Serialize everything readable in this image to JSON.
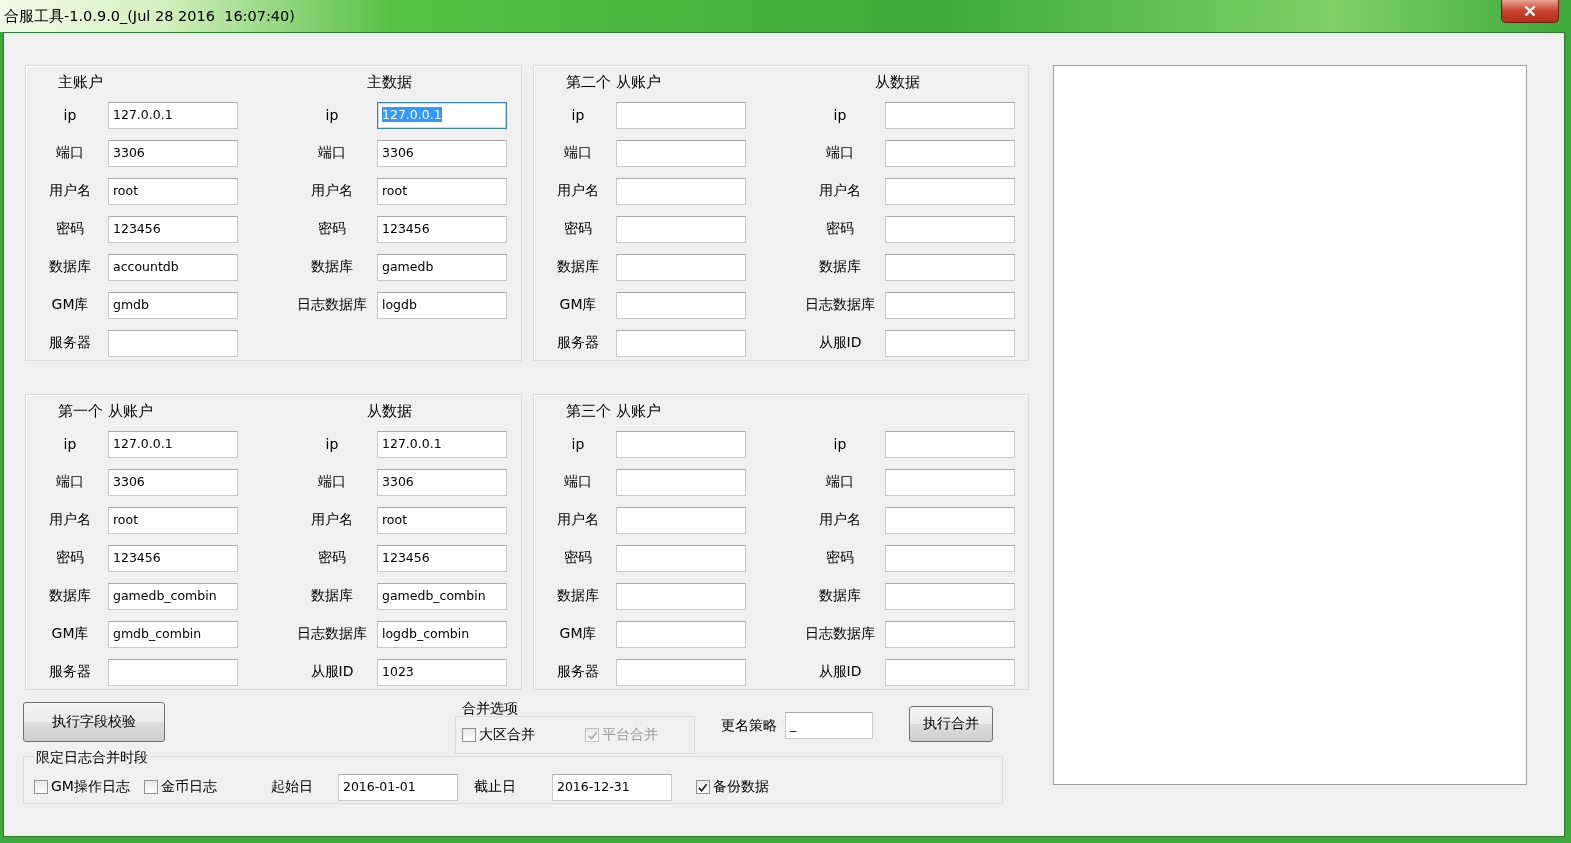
{
  "window": {
    "title": "合服工具-1.0.9.0_(Jul 28 2016  16:07:40)"
  },
  "panels": [
    {
      "columns": [
        {
          "heading": "主账户",
          "fields": [
            {
              "label": "ip",
              "value": "127.0.0.1",
              "highlighted": false
            },
            {
              "label": "端口",
              "value": "3306",
              "highlighted": false
            },
            {
              "label": "用户名",
              "value": "root",
              "highlighted": false
            },
            {
              "label": "密码",
              "value": "123456",
              "highlighted": false
            },
            {
              "label": "数据库",
              "value": "accountdb",
              "highlighted": false
            },
            {
              "label": "GM库",
              "value": "gmdb",
              "highlighted": false
            },
            {
              "label": "服务器",
              "highlighted": false
            }
          ]
        },
        {
          "heading": "主数据",
          "fields": [
            {
              "label": "ip",
              "value": "127.0.0.1",
              "highlighted": true
            },
            {
              "label": "端口",
              "value": "3306",
              "highlighted": false
            },
            {
              "label": "用户名",
              "value": "root",
              "highlighted": false
            },
            {
              "label": "密码",
              "value": "123456",
              "highlighted": false
            },
            {
              "label": "数据库",
              "value": "gamedb",
              "highlighted": false
            },
            {
              "label": "日志数据库",
              "value": "logdb",
              "highlighted": false
            }
          ]
        }
      ]
    },
    {
      "columns": [
        {
          "heading": "第二个 从账户",
          "fields": [
            {
              "label": "ip",
              "highlighted": false
            },
            {
              "label": "端口",
              "highlighted": false
            },
            {
              "label": "用户名",
              "highlighted": false
            },
            {
              "label": "密码",
              "highlighted": false
            },
            {
              "label": "数据库",
              "highlighted": false
            },
            {
              "label": "GM库",
              "highlighted": false
            },
            {
              "label": "服务器",
              "highlighted": false
            }
          ]
        },
        {
          "heading": "从数据",
          "fields": [
            {
              "label": "ip",
              "highlighted": false
            },
            {
              "label": "端口",
              "highlighted": false
            },
            {
              "label": "用户名",
              "highlighted": false
            },
            {
              "label": "密码",
              "highlighted": false
            },
            {
              "label": "数据库",
              "highlighted": false
            },
            {
              "label": "日志数据库",
              "highlighted": false
            },
            {
              "label": "从服ID",
              "highlighted": false
            }
          ]
        }
      ]
    },
    {
      "columns": [
        {
          "heading": "第一个 从账户",
          "fields": [
            {
              "label": "ip",
              "value": "127.0.0.1",
              "highlighted": false
            },
            {
              "label": "端口",
              "value": "3306",
              "highlighted": false
            },
            {
              "label": "用户名",
              "value": "root",
              "highlighted": false
            },
            {
              "label": "密码",
              "value": "123456",
              "highlighted": false
            },
            {
              "label": "数据库",
              "value": "gamedb_combin",
              "highlighted": false
            },
            {
              "label": "GM库",
              "value": "gmdb_combin",
              "highlighted": false
            },
            {
              "label": "服务器",
              "highlighted": false
            }
          ]
        },
        {
          "heading": "从数据",
          "fields": [
            {
              "label": "ip",
              "value": "127.0.0.1",
              "highlighted": false
            },
            {
              "label": "端口",
              "value": "3306",
              "highlighted": false
            },
            {
              "label": "用户名",
              "value": "root",
              "highlighted": false
            },
            {
              "label": "密码",
              "value": "123456",
              "highlighted": false
            },
            {
              "label": "数据库",
              "value": "gamedb_combin",
              "highlighted": false
            },
            {
              "label": "日志数据库",
              "value": "logdb_combin",
              "highlighted": false
            },
            {
              "label": "从服ID",
              "value": "1023",
              "highlighted": false
            }
          ]
        }
      ]
    },
    {
      "columns": [
        {
          "heading": "第三个 从账户",
          "fields": [
            {
              "label": "ip",
              "highlighted": false
            },
            {
              "label": "端口",
              "highlighted": false
            },
            {
              "label": "用户名",
              "highlighted": false
            },
            {
              "label": "密码",
              "highlighted": false
            },
            {
              "label": "数据库",
              "highlighted": false
            },
            {
              "label": "GM库",
              "highlighted": false
            },
            {
              "label": "服务器",
              "highlighted": false
            }
          ]
        },
        {
          "fields": [
            {
              "label": "ip",
              "highlighted": false
            },
            {
              "label": "端口",
              "highlighted": false
            },
            {
              "label": "用户名",
              "highlighted": false
            },
            {
              "label": "密码",
              "highlighted": false
            },
            {
              "label": "数据库",
              "highlighted": false
            },
            {
              "label": "日志数据库",
              "highlighted": false
            },
            {
              "label": "从服ID",
              "highlighted": false
            }
          ]
        }
      ]
    }
  ],
  "validate_button": "执行字段校验",
  "merge_options": {
    "title": "合并选项",
    "checkboxes": [
      {
        "label": "大区合并",
        "checked": false,
        "disabled": false
      },
      {
        "label": "平台合并",
        "checked": true,
        "disabled": true
      }
    ]
  },
  "rename": {
    "label": "更名策略",
    "value": "_"
  },
  "merge_button": "执行合并",
  "log_range": {
    "title": "限定日志合并时段",
    "checkboxes": [
      {
        "label": "GM操作日志",
        "checked": false
      },
      {
        "label": "金币日志",
        "checked": false
      }
    ],
    "start": {
      "label": "起始日",
      "value": "2016-01-01"
    },
    "end": {
      "label": "截止日",
      "value": "2016-12-31"
    },
    "backup": {
      "label": "备份数据",
      "checked": true
    }
  }
}
